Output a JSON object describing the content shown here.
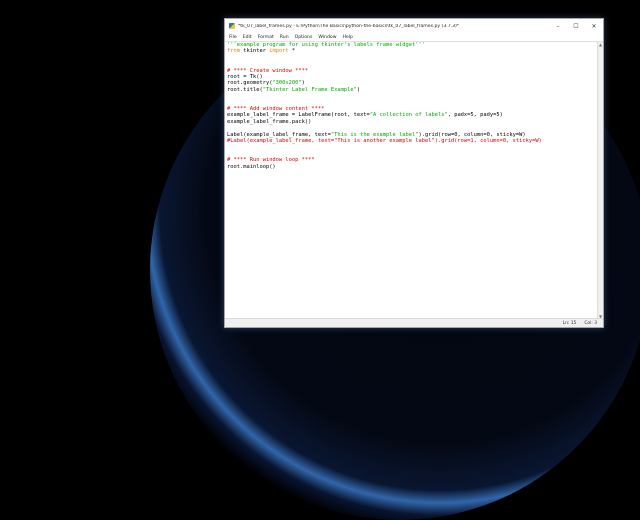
{
  "window": {
    "title": "*tk_07_label_frames.py - E:\\Python\\The Basics\\python-the-basics\\tk_07_label_frames.py (3.7.3)*"
  },
  "titlebar_controls": [
    "–",
    "☐",
    "✕"
  ],
  "menu": [
    "File",
    "Edit",
    "Format",
    "Run",
    "Options",
    "Window",
    "Help"
  ],
  "code": [
    {
      "parts": [
        {
          "t": "'''example program for using tkinter's labels frame widget'''",
          "c": "str"
        }
      ]
    },
    {
      "parts": [
        {
          "t": "from",
          "c": "kw"
        },
        {
          "t": " tkinter ",
          "c": ""
        },
        {
          "t": "import",
          "c": "kw"
        },
        {
          "t": " *",
          "c": ""
        }
      ]
    },
    {
      "parts": []
    },
    {
      "parts": []
    },
    {
      "parts": [
        {
          "t": "# **** Create window ****",
          "c": "cmt"
        }
      ]
    },
    {
      "parts": [
        {
          "t": "root = Tk()",
          "c": ""
        }
      ]
    },
    {
      "parts": [
        {
          "t": "root.geometry(",
          "c": ""
        },
        {
          "t": "\"300x200\"",
          "c": "str"
        },
        {
          "t": ")",
          "c": ""
        }
      ]
    },
    {
      "parts": [
        {
          "t": "root.title(",
          "c": ""
        },
        {
          "t": "\"Tkinter Label Frame Example\"",
          "c": "str"
        },
        {
          "t": ")",
          "c": ""
        }
      ]
    },
    {
      "parts": []
    },
    {
      "parts": []
    },
    {
      "parts": [
        {
          "t": "# **** Add window content ****",
          "c": "cmt"
        }
      ]
    },
    {
      "parts": [
        {
          "t": "example_label_frame = LabelFrame(root, text=",
          "c": ""
        },
        {
          "t": "\"A collection of labels\"",
          "c": "str"
        },
        {
          "t": ", padx=5, pady=5)",
          "c": ""
        }
      ]
    },
    {
      "parts": [
        {
          "t": "example_label_frame.pack()",
          "c": ""
        }
      ]
    },
    {
      "parts": []
    },
    {
      "parts": [
        {
          "t": "Label(example_label_frame, text=",
          "c": ""
        },
        {
          "t": "\"This is the example label\"",
          "c": "str"
        },
        {
          "t": ").grid(row=0, column=0, sticky=W)",
          "c": ""
        }
      ]
    },
    {
      "parts": [
        {
          "t": "#Label(example_label_frame, text=\"This is another example label\").grid(row=1, column=0, sticky=W)",
          "c": "cmt"
        }
      ]
    },
    {
      "parts": []
    },
    {
      "parts": []
    },
    {
      "parts": [
        {
          "t": "# **** Run window loop ****",
          "c": "cmt"
        }
      ]
    },
    {
      "parts": [
        {
          "t": "root.mainloop()",
          "c": ""
        }
      ]
    }
  ],
  "status": {
    "line": "Ln: 15",
    "col": "Col: 3"
  },
  "colors": {
    "string": "#00aa00",
    "keyword": "#ff7700",
    "comment": "#dd0000"
  }
}
